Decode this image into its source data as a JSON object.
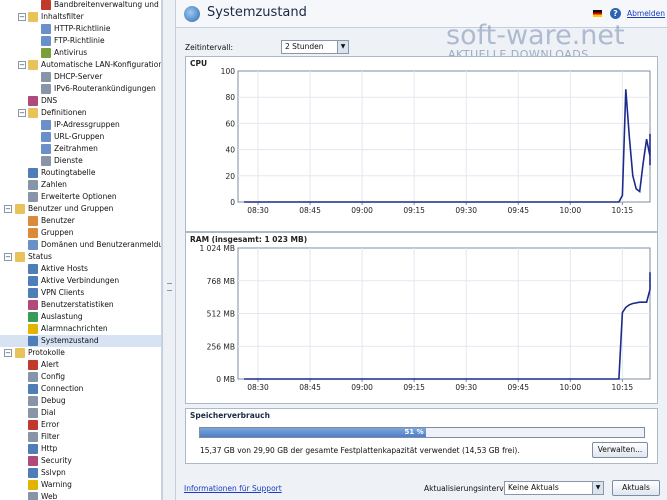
{
  "header": {
    "title": "Systemzustand",
    "logout": "Abmelden",
    "help": "?"
  },
  "watermark": {
    "main": "soft-ware.net",
    "sub": "AKTUELLE DOWNLOADS"
  },
  "interval": {
    "label": "Zeitintervall:",
    "value": "2 Stunden"
  },
  "sidebar": {
    "items": [
      {
        "label": "Bandbreitenverwaltung und QoS",
        "level": 2,
        "toggle": "",
        "icon": "bandwidth-icon",
        "color": "#c0392b"
      },
      {
        "label": "Inhaltsfilter",
        "level": 1,
        "toggle": "−",
        "icon": "folder-icon",
        "color": "#e8c25a"
      },
      {
        "label": "HTTP-Richtlinie",
        "level": 2,
        "toggle": "",
        "icon": "policy-icon",
        "color": "#6b8fc9"
      },
      {
        "label": "FTP-Richtlinie",
        "level": 2,
        "toggle": "",
        "icon": "policy-icon",
        "color": "#6b8fc9"
      },
      {
        "label": "Antivirus",
        "level": 2,
        "toggle": "",
        "icon": "antivirus-icon",
        "color": "#7a9f3a"
      },
      {
        "label": "Automatische LAN-Konfiguration",
        "level": 1,
        "toggle": "−",
        "icon": "folder-icon",
        "color": "#e8c25a"
      },
      {
        "label": "DHCP-Server",
        "level": 2,
        "toggle": "",
        "icon": "server-icon",
        "color": "#8895a8"
      },
      {
        "label": "IPv6-Routerankündigungen",
        "level": 2,
        "toggle": "",
        "icon": "router-icon",
        "color": "#8895a8"
      },
      {
        "label": "DNS",
        "level": 1,
        "toggle": "",
        "icon": "dns-icon",
        "color": "#b04a7a"
      },
      {
        "label": "Definitionen",
        "level": 1,
        "toggle": "−",
        "icon": "folder-icon",
        "color": "#e8c25a"
      },
      {
        "label": "IP-Adressgruppen",
        "level": 2,
        "toggle": "",
        "icon": "group-icon",
        "color": "#6b8fc9"
      },
      {
        "label": "URL-Gruppen",
        "level": 2,
        "toggle": "",
        "icon": "group-icon",
        "color": "#6b8fc9"
      },
      {
        "label": "Zeitrahmen",
        "level": 2,
        "toggle": "",
        "icon": "clock-icon",
        "color": "#6b8fc9"
      },
      {
        "label": "Dienste",
        "level": 2,
        "toggle": "",
        "icon": "service-icon",
        "color": "#8895a8"
      },
      {
        "label": "Routingtabelle",
        "level": 1,
        "toggle": "",
        "icon": "routing-icon",
        "color": "#4e7db8"
      },
      {
        "label": "Zahlen",
        "level": 1,
        "toggle": "",
        "icon": "numbers-icon",
        "color": "#8895a8"
      },
      {
        "label": "Erweiterte Optionen",
        "level": 1,
        "toggle": "",
        "icon": "options-icon",
        "color": "#8895a8"
      },
      {
        "label": "Benutzer und Gruppen",
        "level": 0,
        "toggle": "−",
        "icon": "folder-icon",
        "color": "#e8c25a"
      },
      {
        "label": "Benutzer",
        "level": 1,
        "toggle": "",
        "icon": "user-icon",
        "color": "#d98a3a"
      },
      {
        "label": "Gruppen",
        "level": 1,
        "toggle": "",
        "icon": "users-icon",
        "color": "#d98a3a"
      },
      {
        "label": "Domänen und Benutzeranmeldung",
        "level": 1,
        "toggle": "",
        "icon": "domain-icon",
        "color": "#6b8fc9"
      },
      {
        "label": "Status",
        "level": 0,
        "toggle": "−",
        "icon": "folder-icon",
        "color": "#e8c25a"
      },
      {
        "label": "Aktive Hosts",
        "level": 1,
        "toggle": "",
        "icon": "hosts-icon",
        "color": "#4e7db8"
      },
      {
        "label": "Aktive Verbindungen",
        "level": 1,
        "toggle": "",
        "icon": "connections-icon",
        "color": "#4e7db8"
      },
      {
        "label": "VPN Clients",
        "level": 1,
        "toggle": "",
        "icon": "vpn-icon",
        "color": "#4e7db8"
      },
      {
        "label": "Benutzerstatistiken",
        "level": 1,
        "toggle": "",
        "icon": "stats-icon",
        "color": "#b04a7a"
      },
      {
        "label": "Auslastung",
        "level": 1,
        "toggle": "",
        "icon": "load-icon",
        "color": "#3a9a5a"
      },
      {
        "label": "Alarmnachrichten",
        "level": 1,
        "toggle": "",
        "icon": "warning-icon",
        "color": "#e2b400"
      },
      {
        "label": "Systemzustand",
        "level": 1,
        "toggle": "",
        "icon": "system-icon",
        "color": "#4e7db8",
        "selected": true
      },
      {
        "label": "Protokolle",
        "level": 0,
        "toggle": "−",
        "icon": "folder-icon",
        "color": "#e8c25a"
      },
      {
        "label": "Alert",
        "level": 1,
        "toggle": "",
        "icon": "log-icon",
        "color": "#c0392b"
      },
      {
        "label": "Config",
        "level": 1,
        "toggle": "",
        "icon": "log-icon",
        "color": "#8895a8"
      },
      {
        "label": "Connection",
        "level": 1,
        "toggle": "",
        "icon": "log-icon",
        "color": "#4e7db8"
      },
      {
        "label": "Debug",
        "level": 1,
        "toggle": "",
        "icon": "log-icon",
        "color": "#8895a8"
      },
      {
        "label": "Dial",
        "level": 1,
        "toggle": "",
        "icon": "log-icon",
        "color": "#8895a8"
      },
      {
        "label": "Error",
        "level": 1,
        "toggle": "",
        "icon": "log-icon",
        "color": "#c0392b"
      },
      {
        "label": "Filter",
        "level": 1,
        "toggle": "",
        "icon": "log-icon",
        "color": "#8895a8"
      },
      {
        "label": "Http",
        "level": 1,
        "toggle": "",
        "icon": "log-icon",
        "color": "#4e7db8"
      },
      {
        "label": "Security",
        "level": 1,
        "toggle": "",
        "icon": "log-icon",
        "color": "#b04a7a"
      },
      {
        "label": "Sslvpn",
        "level": 1,
        "toggle": "",
        "icon": "log-icon",
        "color": "#4e7db8"
      },
      {
        "label": "Warning",
        "level": 1,
        "toggle": "",
        "icon": "log-icon",
        "color": "#e2b400"
      },
      {
        "label": "Web",
        "level": 1,
        "toggle": "",
        "icon": "log-icon",
        "color": "#8895a8"
      }
    ]
  },
  "chart_data": [
    {
      "type": "line",
      "title": "CPU",
      "x_ticks": [
        "08:30",
        "08:45",
        "09:00",
        "09:15",
        "09:30",
        "09:45",
        "10:00",
        "10:15"
      ],
      "y_ticks": [
        "0",
        "20",
        "40",
        "60",
        "80",
        "100"
      ],
      "ylim": [
        0,
        100
      ],
      "x_minutes_from_first_tick": [
        -4,
        104,
        105,
        106,
        107,
        108,
        109,
        110,
        111,
        112,
        113,
        114,
        115,
        116,
        117,
        118,
        119,
        120,
        121,
        122,
        123,
        124
      ],
      "values": [
        0,
        0,
        5,
        86,
        50,
        20,
        10,
        8,
        30,
        48,
        35,
        50,
        42,
        52,
        30,
        48,
        45,
        28,
        42,
        40,
        35,
        30
      ],
      "color": "#1c2a8a"
    },
    {
      "type": "line",
      "title": "RAM (insgesamt: 1 023 MB)",
      "x_ticks": [
        "08:30",
        "08:45",
        "09:00",
        "09:15",
        "09:30",
        "09:45",
        "10:00",
        "10:15"
      ],
      "y_ticks": [
        "0 MB",
        "256 MB",
        "512 MB",
        "768 MB",
        "1 024 MB"
      ],
      "ylim": [
        0,
        1024
      ],
      "x_minutes_from_first_tick": [
        -4,
        104,
        105,
        106,
        107,
        108,
        110,
        112,
        113,
        115,
        116,
        118,
        120,
        121,
        123,
        124
      ],
      "values": [
        0,
        0,
        520,
        560,
        580,
        590,
        600,
        600,
        700,
        700,
        780,
        790,
        800,
        820,
        830,
        835
      ],
      "color": "#1c2a8a"
    }
  ],
  "usage": {
    "title": "Speicherverbrauch",
    "percent_label": "51 %",
    "percent": 51,
    "text": "15,37 GB von 29,90 GB der gesamte Festplattenkapazität verwendet (14,53 GB frei).",
    "details_button": "Verwalten..."
  },
  "footer": {
    "support_link": "Informationen für Support",
    "update_label": "Aktualisierungsintervall:",
    "update_value": "Keine Aktuals",
    "refresh_button": "Aktuals"
  }
}
